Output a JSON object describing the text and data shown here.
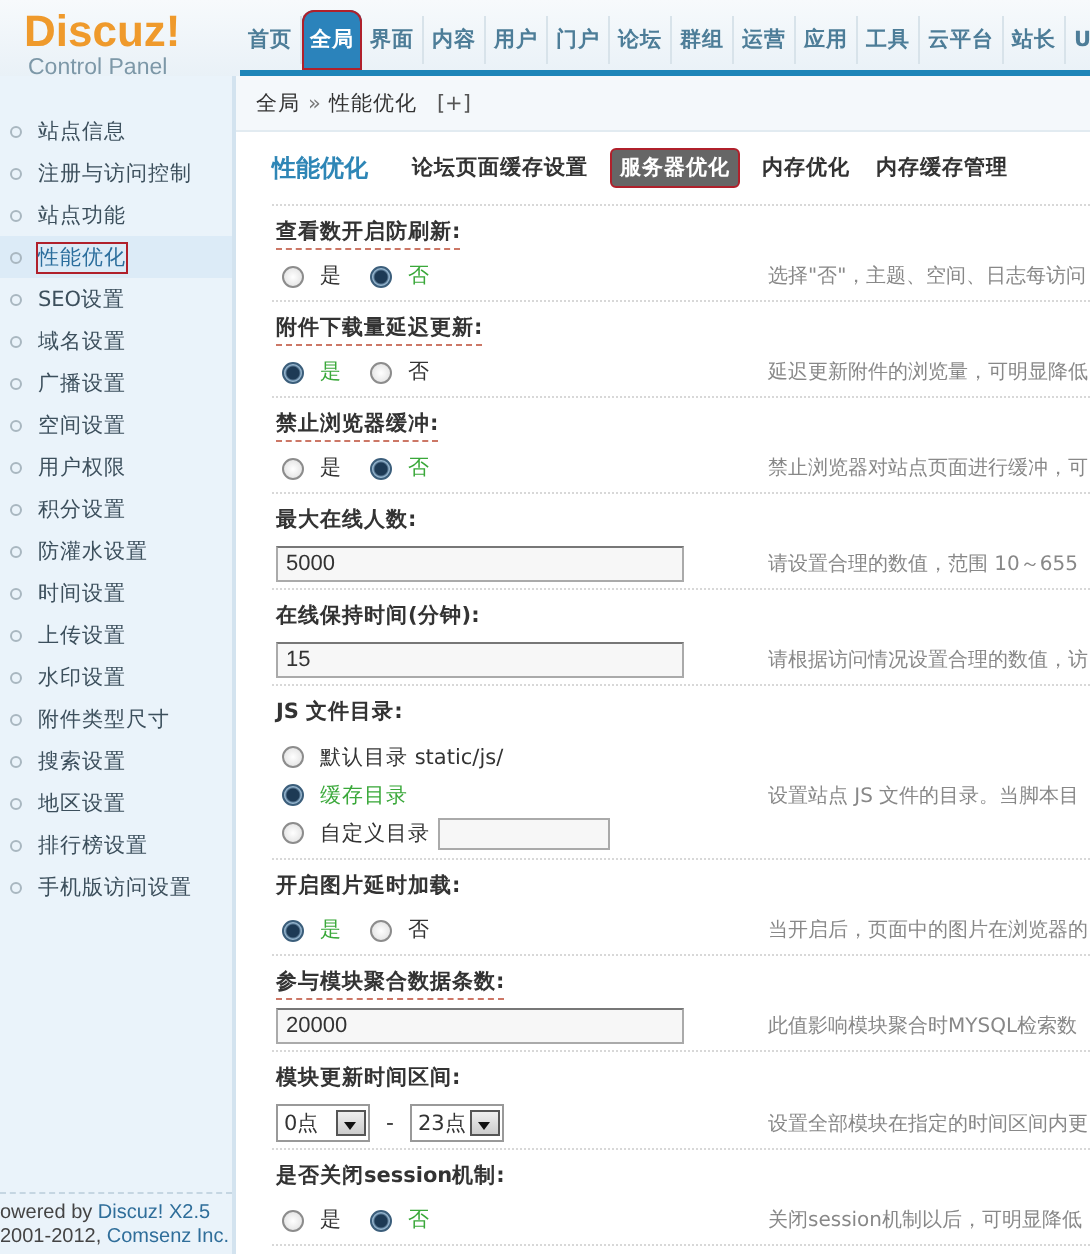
{
  "logo": {
    "title": "Discuz!",
    "subtitle": "Control Panel"
  },
  "nav": [
    {
      "label": "首页",
      "selected": false,
      "highlighted": false
    },
    {
      "label": "全局",
      "selected": true,
      "highlighted": true
    },
    {
      "label": "界面",
      "selected": false,
      "highlighted": false
    },
    {
      "label": "内容",
      "selected": false,
      "highlighted": false
    },
    {
      "label": "用户",
      "selected": false,
      "highlighted": false
    },
    {
      "label": "门户",
      "selected": false,
      "highlighted": false
    },
    {
      "label": "论坛",
      "selected": false,
      "highlighted": false
    },
    {
      "label": "群组",
      "selected": false,
      "highlighted": false
    },
    {
      "label": "运营",
      "selected": false,
      "highlighted": false
    },
    {
      "label": "应用",
      "selected": false,
      "highlighted": false
    },
    {
      "label": "工具",
      "selected": false,
      "highlighted": false
    },
    {
      "label": "云平台",
      "selected": false,
      "highlighted": false
    },
    {
      "label": "站长",
      "selected": false,
      "highlighted": false
    },
    {
      "label": "U",
      "selected": false,
      "highlighted": false
    }
  ],
  "breadcrumb": {
    "items": [
      "全局",
      "性能优化"
    ],
    "separator": "»",
    "add": "[+]"
  },
  "sidebar": {
    "items": [
      {
        "label": "站点信息",
        "selected": false,
        "highlighted": false
      },
      {
        "label": "注册与访问控制",
        "selected": false,
        "highlighted": false
      },
      {
        "label": "站点功能",
        "selected": false,
        "highlighted": false
      },
      {
        "label": "性能优化",
        "selected": true,
        "highlighted": true
      },
      {
        "label": "SEO设置",
        "selected": false,
        "highlighted": false
      },
      {
        "label": "域名设置",
        "selected": false,
        "highlighted": false
      },
      {
        "label": "广播设置",
        "selected": false,
        "highlighted": false
      },
      {
        "label": "空间设置",
        "selected": false,
        "highlighted": false
      },
      {
        "label": "用户权限",
        "selected": false,
        "highlighted": false
      },
      {
        "label": "积分设置",
        "selected": false,
        "highlighted": false
      },
      {
        "label": "防灌水设置",
        "selected": false,
        "highlighted": false
      },
      {
        "label": "时间设置",
        "selected": false,
        "highlighted": false
      },
      {
        "label": "上传设置",
        "selected": false,
        "highlighted": false
      },
      {
        "label": "水印设置",
        "selected": false,
        "highlighted": false
      },
      {
        "label": "附件类型尺寸",
        "selected": false,
        "highlighted": false
      },
      {
        "label": "搜索设置",
        "selected": false,
        "highlighted": false
      },
      {
        "label": "地区设置",
        "selected": false,
        "highlighted": false
      },
      {
        "label": "排行榜设置",
        "selected": false,
        "highlighted": false
      },
      {
        "label": "手机版访问设置",
        "selected": false,
        "highlighted": false
      }
    ],
    "footer": {
      "powered": "owered by ",
      "product": "Discuz! X2.5",
      "copyright": "2001-2012, ",
      "company": "Comsenz Inc."
    }
  },
  "page": {
    "title": "性能优化",
    "tabs": [
      {
        "label": "论坛页面缓存设置",
        "selected": false,
        "highlighted": false
      },
      {
        "label": "服务器优化",
        "selected": true,
        "highlighted": true
      },
      {
        "label": "内存优化",
        "selected": false,
        "highlighted": false
      },
      {
        "label": "内存缓存管理",
        "selected": false,
        "highlighted": false
      }
    ]
  },
  "settings": [
    {
      "kind": "radio",
      "label": "查看数开启防刷新:",
      "tip": true,
      "hint": "选择\"否\"，主题、空间、日志每访问",
      "options": [
        {
          "label": "是",
          "selected": false
        },
        {
          "label": "否",
          "selected": true
        }
      ]
    },
    {
      "kind": "radio",
      "label": "附件下载量延迟更新:",
      "tip": true,
      "hint": "延迟更新附件的浏览量，可明显降低",
      "options": [
        {
          "label": "是",
          "selected": true
        },
        {
          "label": "否",
          "selected": false
        }
      ]
    },
    {
      "kind": "radio",
      "label": "禁止浏览器缓冲:",
      "tip": true,
      "hint": "禁止浏览器对站点页面进行缓冲，可",
      "options": [
        {
          "label": "是",
          "selected": false
        },
        {
          "label": "否",
          "selected": true
        }
      ]
    },
    {
      "kind": "text",
      "label": "最大在线人数:",
      "tip": false,
      "hint": "请设置合理的数值，范围 10～655",
      "value": "5000"
    },
    {
      "kind": "text",
      "label": "在线保持时间(分钟):",
      "tip": false,
      "hint": "请根据访问情况设置合理的数值，访",
      "value": "15"
    },
    {
      "kind": "list",
      "label": "JS 文件目录:",
      "tip": false,
      "hint": "设置站点 JS 文件的目录。当脚本目",
      "options": [
        {
          "label": "默认目录 static/js/",
          "selected": false,
          "custom": false
        },
        {
          "label": "缓存目录",
          "selected": true,
          "custom": false
        },
        {
          "label": "自定义目录",
          "selected": false,
          "custom": true
        }
      ]
    },
    {
      "kind": "radio",
      "label": "开启图片延时加载:",
      "tip": false,
      "hint": "当开启后，页面中的图片在浏览器的",
      "options": [
        {
          "label": "是",
          "selected": true
        },
        {
          "label": "否",
          "selected": false
        }
      ]
    },
    {
      "kind": "text",
      "label": "参与模块聚合数据条数:",
      "tip": true,
      "hint": "此值影响模块聚合时MYSQL检索数",
      "value": "20000"
    },
    {
      "kind": "range",
      "label": "模块更新时间区间:",
      "tip": false,
      "hint": "设置全部模块在指定的时间区间内更",
      "from": "0点",
      "separator": "-",
      "to": "23点"
    },
    {
      "kind": "radio",
      "label": "是否关闭session机制:",
      "tip": false,
      "hint": "关闭session机制以后，可明显降低",
      "options": [
        {
          "label": "是",
          "selected": false
        },
        {
          "label": "否",
          "selected": true
        }
      ]
    }
  ]
}
